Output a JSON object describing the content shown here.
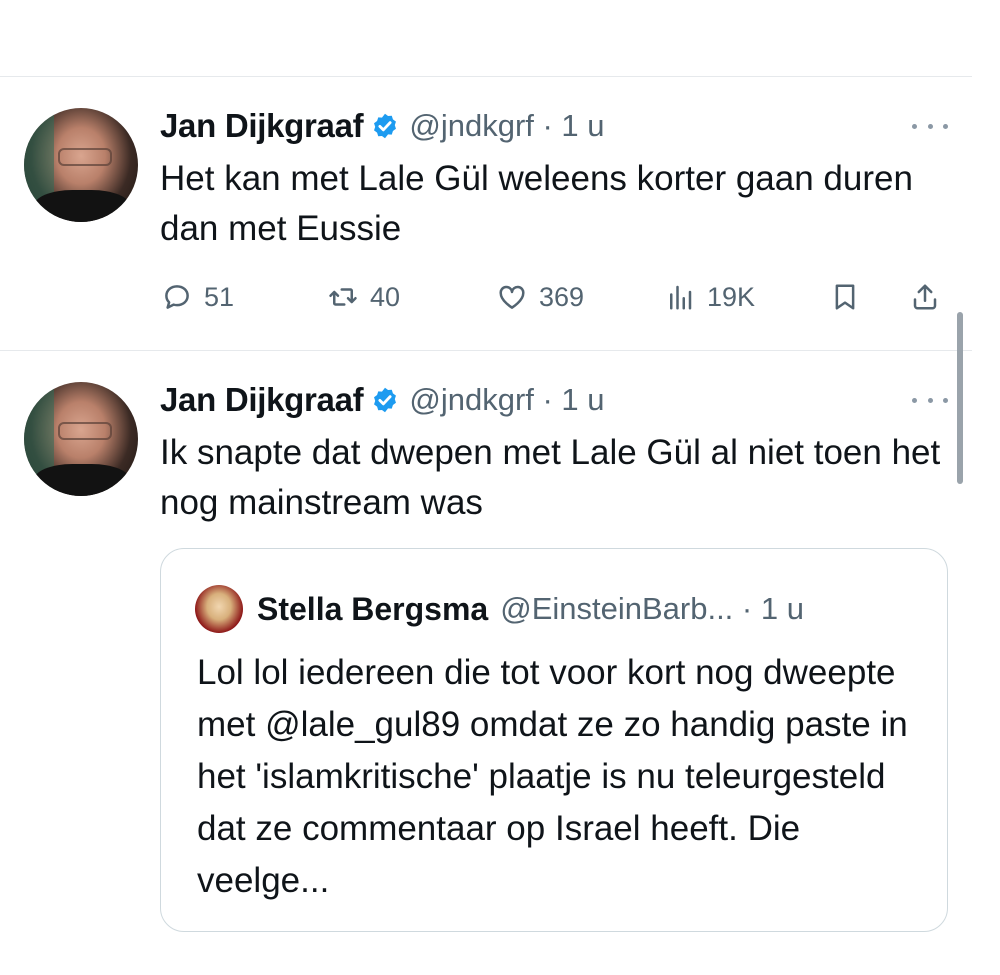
{
  "tweets": [
    {
      "author": "Jan Dijkgraaf",
      "meta": "@jndkgrf · 1 u",
      "text": "Het kan met Lale Gül weleens korter gaan duren dan met Eussie",
      "stats": {
        "replies": "51",
        "reposts": "40",
        "likes": "369",
        "views": "19K"
      }
    },
    {
      "author": "Jan Dijkgraaf",
      "meta": "@jndkgrf · 1 u",
      "text": "Ik snapte dat dwepen met Lale Gül al niet toen het nog mainstream was",
      "quote": {
        "author": "Stella Bergsma",
        "meta": "@EinsteinBarb... · 1 u",
        "text": "Lol lol iedereen die tot voor kort nog dweepte met @lale_gul89 omdat ze zo handig paste in het 'islamkritische' plaatje is nu teleurgesteld dat ze commentaar op Israel heeft. Die veelge..."
      }
    }
  ],
  "colors": {
    "text": "#0f1419",
    "muted": "#536471",
    "verified": "#1d9bf0",
    "divider": "#e6e9ec"
  },
  "icons": [
    "verified-badge-icon",
    "more-icon",
    "reply-icon",
    "repost-icon",
    "like-icon",
    "views-icon",
    "bookmark-icon",
    "share-icon"
  ]
}
